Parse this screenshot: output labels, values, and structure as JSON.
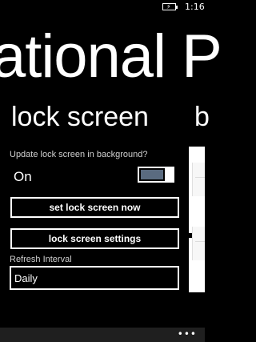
{
  "status_bar": {
    "time": "1:16",
    "battery_icon": "battery-charging-icon"
  },
  "panorama": {
    "title": "ational P",
    "section_title": "lock screen",
    "next_section_title": "b"
  },
  "lock_screen": {
    "update_label": "Update lock screen in background?",
    "toggle_state_text": "On",
    "toggle_on": true,
    "set_now_button": "set lock screen now",
    "settings_button": "lock screen settings",
    "refresh_interval_label": "Refresh Interval",
    "refresh_interval_value": "Daily"
  },
  "app_bar": {
    "more_label": "•••"
  },
  "colors": {
    "background": "#000000",
    "foreground": "#ffffff",
    "toggle_fill": "#5a6b80",
    "app_bar": "#1f1f1f"
  }
}
